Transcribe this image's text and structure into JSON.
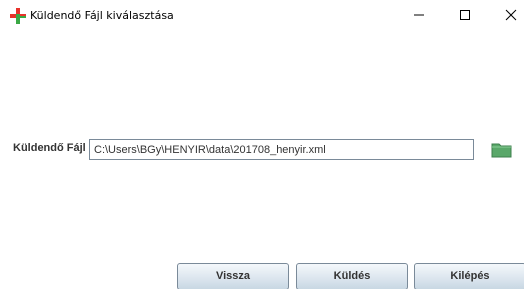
{
  "window": {
    "title": "Küldendő Fájl kiválasztása",
    "app_icon": "plus-cross-icon",
    "controls": {
      "minimize_icon": "minimize-icon",
      "maximize_icon": "maximize-icon",
      "close_icon": "close-icon"
    }
  },
  "form": {
    "file_label": "Küldendő Fájl",
    "file_path": "C:\\Users\\BGy\\HENYIR\\data\\201708_henyir.xml",
    "browse_icon": "folder-icon"
  },
  "buttons": {
    "back_label": "Vissza",
    "send_label": "Küldés",
    "exit_label": "Kilépés"
  },
  "colors": {
    "icon_red": "#e8322b",
    "icon_green": "#3aa845",
    "folder_green": "#5aa86a",
    "button_border": "#7a8a99"
  }
}
